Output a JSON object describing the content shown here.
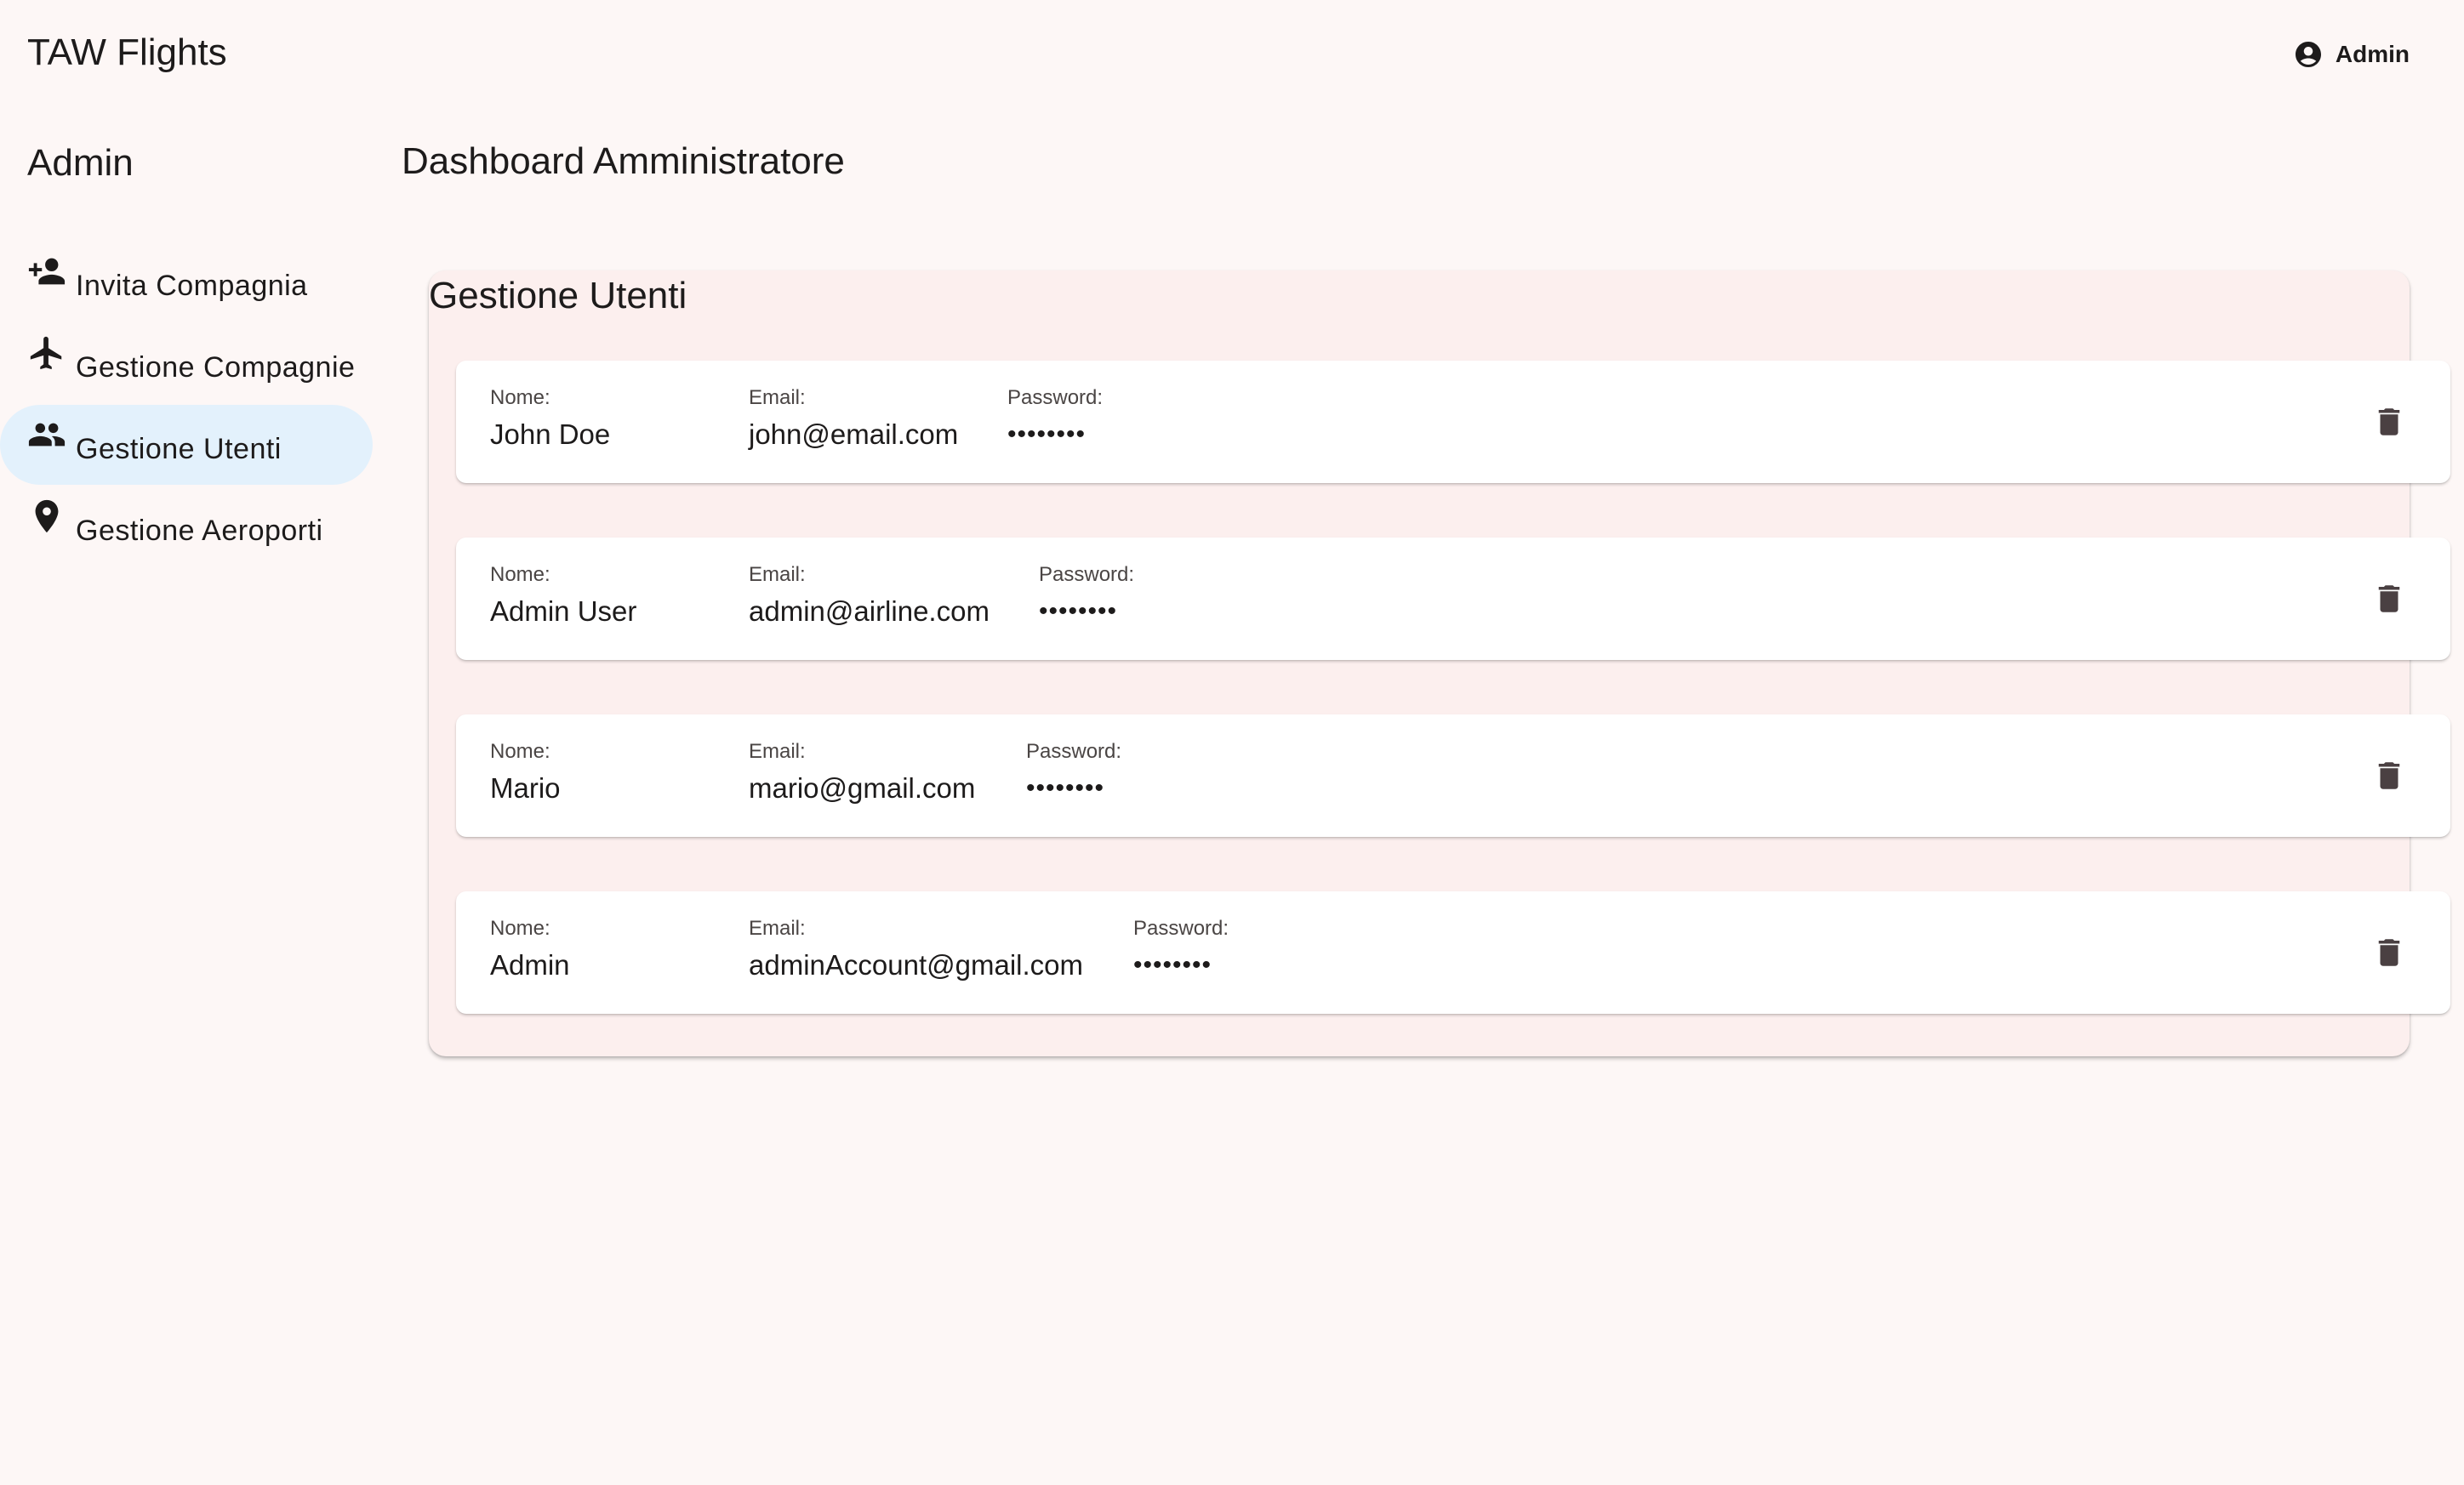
{
  "app": {
    "title": "TAW Flights"
  },
  "account": {
    "label": "Admin",
    "icon": "account-circle-icon"
  },
  "sidebar": {
    "title": "Admin",
    "items": [
      {
        "label": "Invita Compagnia",
        "icon": "person-add-icon",
        "active": false
      },
      {
        "label": "Gestione Compagnie",
        "icon": "airplane-icon",
        "active": false
      },
      {
        "label": "Gestione Utenti",
        "icon": "people-icon",
        "active": true
      },
      {
        "label": "Gestione Aeroporti",
        "icon": "location-pin-icon",
        "active": false
      }
    ]
  },
  "main": {
    "title": "Dashboard Amministratore",
    "panel": {
      "title": "Gestione Utenti",
      "labels": {
        "name": "Nome:",
        "email": "Email:",
        "password": "Password:"
      },
      "users": [
        {
          "name": "John Doe",
          "email": "john@email.com",
          "password": "••••••••"
        },
        {
          "name": "Admin User",
          "email": "admin@airline.com",
          "password": "••••••••"
        },
        {
          "name": "Mario",
          "email": "mario@gmail.com",
          "password": "••••••••"
        },
        {
          "name": "Admin",
          "email": "adminAccount@gmail.com",
          "password": "••••••••"
        }
      ]
    }
  },
  "colors": {
    "background": "#fdf7f6",
    "active_nav": "#e3f1fc",
    "panel": "#fcefee",
    "card": "#ffffff",
    "icon": "#1d1b1b",
    "delete_icon": "#4a4042"
  }
}
